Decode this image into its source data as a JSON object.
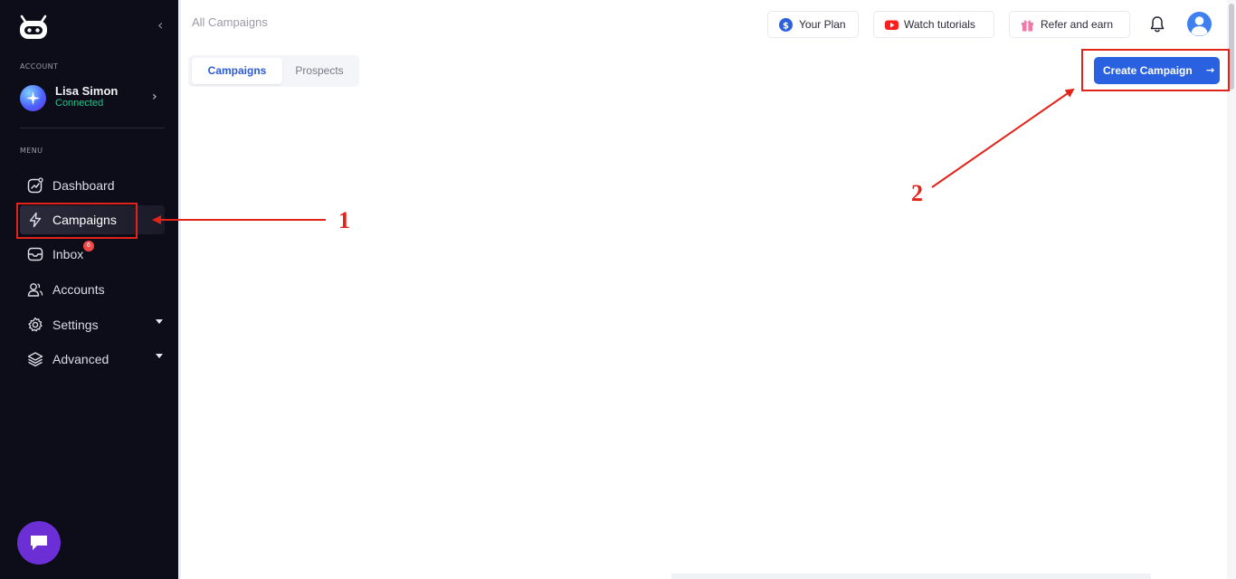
{
  "sidebar": {
    "account_section": "ACCOUNT",
    "menu_section": "MENU",
    "account": {
      "name": "Lisa Simon",
      "status": "Connected"
    },
    "items": [
      {
        "label": "Dashboard",
        "icon": "dashboard-icon"
      },
      {
        "label": "Campaigns",
        "icon": "lightning-icon",
        "active": true
      },
      {
        "label": "Inbox",
        "icon": "inbox-icon",
        "badge": "6"
      },
      {
        "label": "Accounts",
        "icon": "users-icon"
      },
      {
        "label": "Settings",
        "icon": "gear-icon",
        "expandable": true
      },
      {
        "label": "Advanced",
        "icon": "layers-icon",
        "expandable": true
      }
    ]
  },
  "header": {
    "title": "All Campaigns",
    "your_plan": "Your Plan",
    "watch_tutorials": "Watch tutorials",
    "refer_and_earn": "Refer and earn"
  },
  "tabs": [
    {
      "label": "Campaigns",
      "active": true
    },
    {
      "label": "Prospects",
      "active": false
    }
  ],
  "create_button": {
    "label": "Create Campaign"
  },
  "annotations": [
    {
      "number": "1"
    },
    {
      "number": "2"
    }
  ],
  "colors": {
    "sidebar_bg": "#0d0d1a",
    "accent": "#2a61e0",
    "annotation": "#e2231a",
    "connected": "#23c48c",
    "chat_button": "#6c2fd6"
  }
}
